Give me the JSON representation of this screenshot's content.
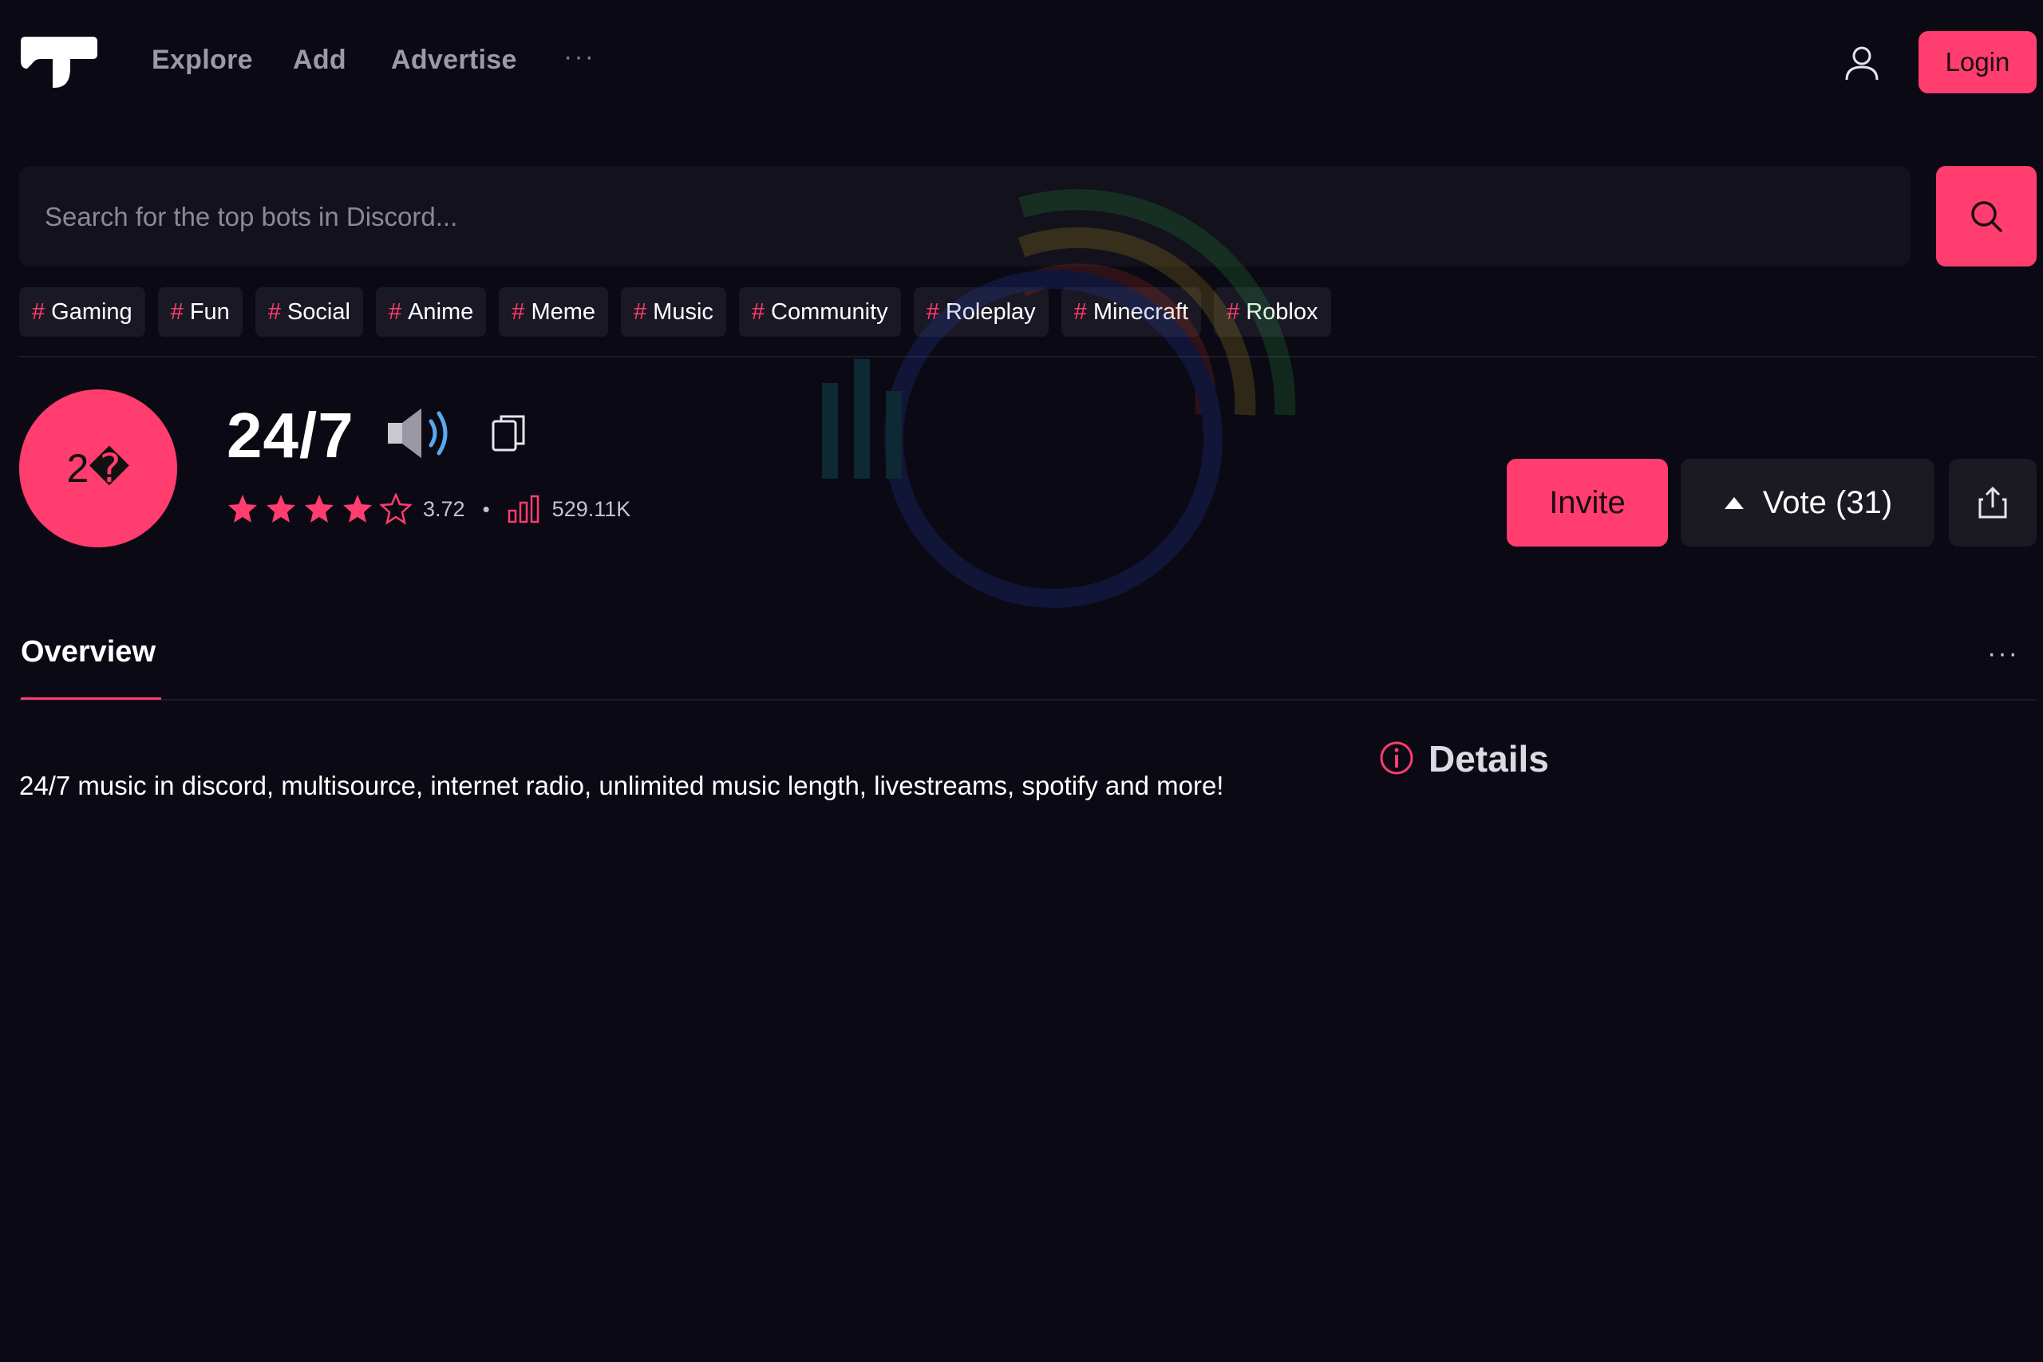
{
  "nav": {
    "links": [
      "Explore",
      "Add",
      "Advertise"
    ],
    "more": "···",
    "login_label": "Login"
  },
  "search": {
    "placeholder": "Search for the top bots in Discord..."
  },
  "tags": [
    "Gaming",
    "Fun",
    "Social",
    "Anime",
    "Meme",
    "Music",
    "Community",
    "Roleplay",
    "Minecraft",
    "Roblox"
  ],
  "bot": {
    "avatar_text": "2�",
    "title": "24/7",
    "rating": 3.72,
    "rating_text": "3.72",
    "stars_filled": 4,
    "stars_total": 5,
    "dot": "•",
    "stats": "529.11K",
    "invite_label": "Invite",
    "vote_label": "Vote (31)"
  },
  "tabs": {
    "overview": "Overview",
    "more": "···"
  },
  "content": {
    "description": "24/7 music in discord, multisource, internet radio, unlimited music length, livestreams, spotify and more!",
    "details_title": "Details"
  },
  "colors": {
    "background": "#0b0914",
    "accent": "#ff3d6e",
    "surface": "#1a1824",
    "muted_text": "#9b9aa6"
  },
  "icons": [
    "logo-icon",
    "user-icon",
    "search-icon",
    "hash-icon",
    "speaker-icon",
    "copy-icon",
    "star-icon",
    "stats-icon",
    "caret-up-icon",
    "share-icon",
    "info-icon"
  ]
}
